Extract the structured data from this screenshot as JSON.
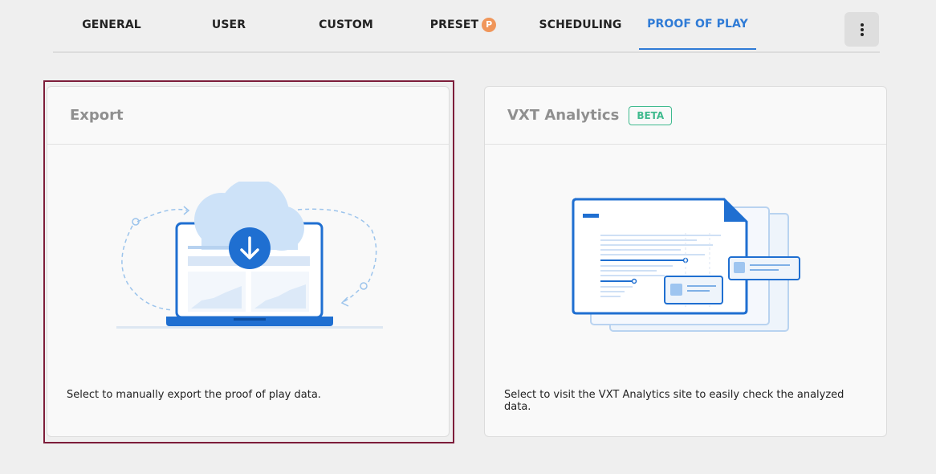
{
  "tabs": [
    {
      "label": "GENERAL",
      "active": false
    },
    {
      "label": "USER",
      "active": false
    },
    {
      "label": "CUSTOM",
      "active": false
    },
    {
      "label": "PRESET",
      "active": false,
      "badge": "P"
    },
    {
      "label": "SCHEDULING",
      "active": false
    },
    {
      "label": "PROOF OF PLAY",
      "active": true
    }
  ],
  "more_button_icon": "more-vertical-icon",
  "cards": {
    "export": {
      "title": "Export",
      "description": "Select to manually export the proof of play data.",
      "selected": true,
      "illustration": "cloud-download-laptop-illustration"
    },
    "analytics": {
      "title": "VXT Analytics",
      "badge": "BETA",
      "description": "Select to visit the VXT Analytics site to easily check the analyzed data.",
      "illustration": "analytics-report-illustration"
    }
  },
  "colors": {
    "accent": "#2f7bd6",
    "selection_border": "#7d1d3a",
    "beta_green": "#3fba8e",
    "preset_badge": "#f0965a"
  }
}
